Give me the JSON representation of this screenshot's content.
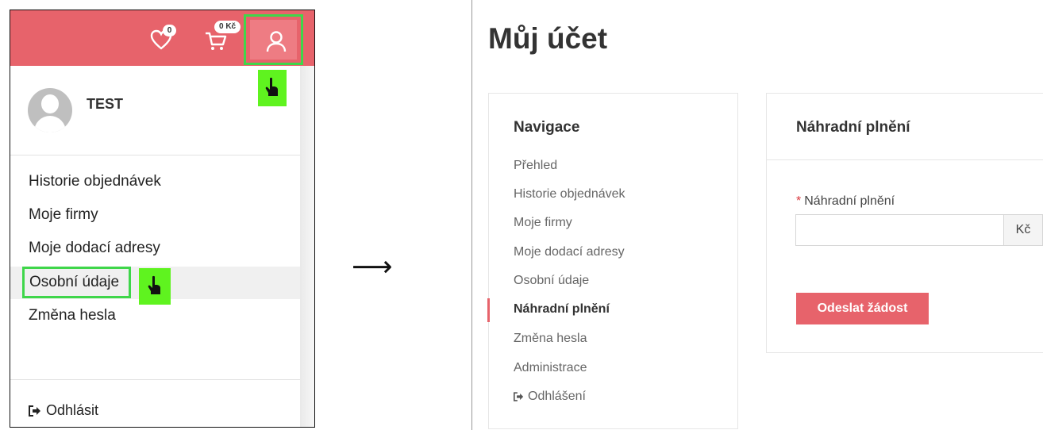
{
  "left": {
    "wishlist_count": "0",
    "cart_total": "0 Kč",
    "user_name": "TEST",
    "menu_items": [
      "Historie objednávek",
      "Moje firmy",
      "Moje dodací adresy",
      "Osobní údaje",
      "Změna hesla"
    ],
    "logout_label": "Odhlásit"
  },
  "arrow": "⟶",
  "right": {
    "page_title": "Můj účet",
    "nav_heading": "Navigace",
    "nav_items": [
      "Přehled",
      "Historie objednávek",
      "Moje firmy",
      "Moje dodací adresy",
      "Osobní údaje",
      "Náhradní plnění",
      "Změna hesla",
      "Administrace",
      "Odhlášení"
    ],
    "active_nav": "Náhradní plnění",
    "form_title": "Náhradní plnění",
    "field_label": "Náhradní plnění",
    "field_required_mark": "*",
    "field_value": "",
    "currency_addon": "Kč",
    "submit_label": "Odeslat žádost"
  },
  "colors": {
    "brand": "#e7636b",
    "highlight": "#3fd64a",
    "cursor_bg": "#5ff31f"
  }
}
